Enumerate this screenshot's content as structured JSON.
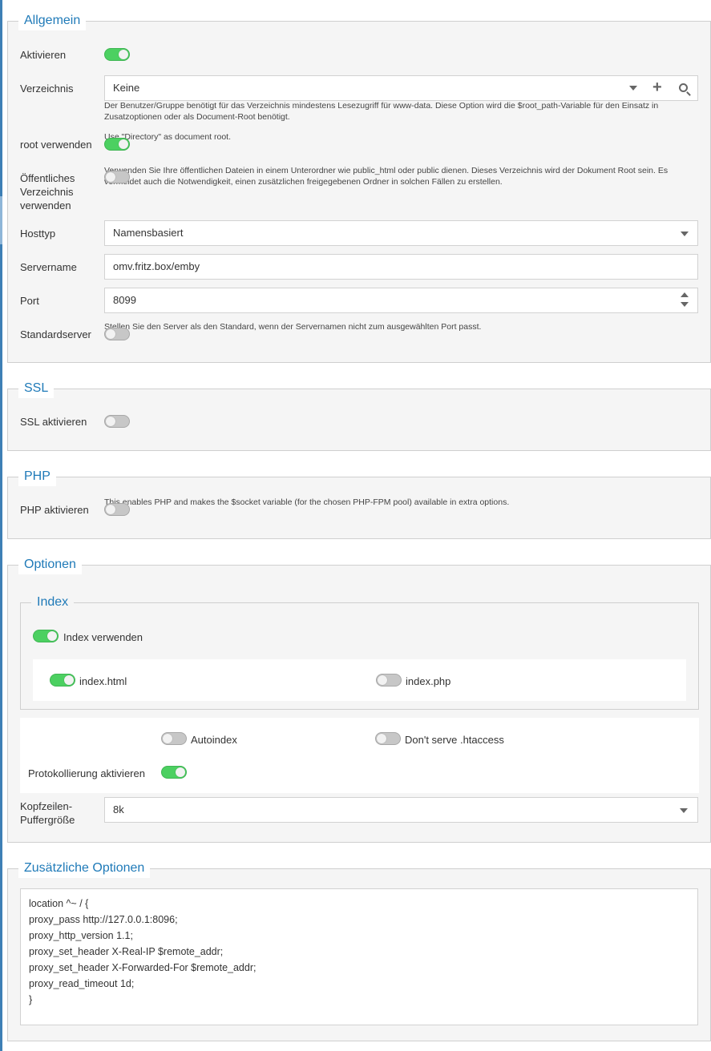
{
  "allgemein": {
    "legend": "Allgemein",
    "aktivieren_label": "Aktivieren",
    "aktivieren_on": true,
    "verzeichnis_label": "Verzeichnis",
    "verzeichnis_value": "Keine",
    "verzeichnis_help": "Der Benutzer/Gruppe benötigt für das Verzeichnis mindestens Lesezugriff für www-data. Diese Option wird die $root_path-Variable für den Einsatz in Zusatzoptionen oder als Document-Root benötigt.",
    "root_label": "root verwenden",
    "root_help": "Use \"Directory\" as document root.",
    "root_on": true,
    "public_label": "Öffentliches Verzeichnis verwenden",
    "public_help": "Verwenden Sie Ihre öffentlichen Dateien in einem Unterordner wie public_html oder public dienen. Dieses Verzeichnis wird der Dokument Root sein. Es vermeidet auch die Notwendigkeit, einen zusätzlichen freigegebenen Ordner in solchen Fällen zu erstellen.",
    "public_on": false,
    "hosttyp_label": "Hosttyp",
    "hosttyp_value": "Namensbasiert",
    "servername_label": "Servername",
    "servername_value": "omv.fritz.box/emby",
    "port_label": "Port",
    "port_value": "8099",
    "standard_label": "Standardserver",
    "standard_help": "Stellen Sie den Server als den Standard, wenn der Servernamen nicht zum ausgewählten Port passt.",
    "standard_on": false
  },
  "ssl": {
    "legend": "SSL",
    "label": "SSL aktivieren",
    "on": false
  },
  "php": {
    "legend": "PHP",
    "label": "PHP aktivieren",
    "help": "This enables PHP and makes the $socket variable (for the chosen PHP-FPM pool) available in extra options.",
    "on": false
  },
  "optionen": {
    "legend": "Optionen",
    "index": {
      "legend": "Index",
      "use_label": "Index verwenden",
      "use_on": true,
      "html_label": "index.html",
      "html_on": true,
      "php_label": "index.php",
      "php_on": false
    },
    "autoindex_label": "Autoindex",
    "autoindex_on": false,
    "htaccess_label": "Don't serve .htaccess",
    "htaccess_on": false,
    "logging_label": "Protokollierung aktivieren",
    "logging_on": true,
    "header_label": "Kopfzeilen-Puffergröße",
    "header_value": "8k"
  },
  "zusatz": {
    "legend": "Zusätzliche Optionen",
    "lines": [
      "location ^~ / {",
      "proxy_pass http://127.0.0.1:8096;",
      "proxy_http_version 1.1;",
      "proxy_set_header X-Real-IP $remote_addr;",
      "proxy_set_header X-Forwarded-For $remote_addr;",
      "proxy_read_timeout 1d;",
      "}"
    ]
  },
  "colors": {
    "accent": "#1f7ab8",
    "toggle_on": "#4cd061",
    "toggle_off": "#c7c7c7",
    "panel_bg": "#f5f5f5"
  }
}
